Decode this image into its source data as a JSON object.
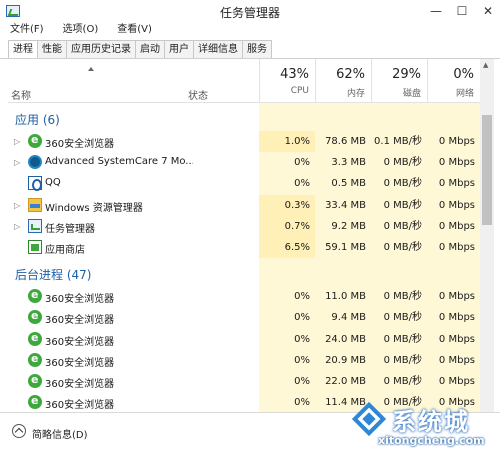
{
  "window": {
    "title": "任务管理器",
    "controls": {
      "minimize": "—",
      "maximize": "☐",
      "close": "✕"
    }
  },
  "menu": [
    "文件(F)",
    "选项(O)",
    "查看(V)"
  ],
  "tabs": [
    "进程",
    "性能",
    "应用历史记录",
    "启动",
    "用户",
    "详细信息",
    "服务"
  ],
  "active_tab": "进程",
  "header": {
    "name": "名称",
    "status": "状态",
    "cpu": {
      "percent": "43%",
      "label": "CPU"
    },
    "memory": {
      "percent": "62%",
      "label": "内存"
    },
    "disk": {
      "percent": "29%",
      "label": "磁盘"
    },
    "network": {
      "percent": "0%",
      "label": "网络"
    }
  },
  "groups": {
    "apps": {
      "label": "应用 (6)",
      "rows": [
        {
          "name": "360安全浏览器",
          "icon": "360-browser-icon",
          "expandable": true,
          "cpu": "1.0%",
          "memory": "78.6 MB",
          "disk": "0.1 MB/秒",
          "network": "0 Mbps"
        },
        {
          "name": "Advanced SystemCare 7 Mo...",
          "icon": "advanced-systemcare-icon",
          "expandable": true,
          "cpu": "0%",
          "memory": "3.3 MB",
          "disk": "0 MB/秒",
          "network": "0 Mbps"
        },
        {
          "name": "QQ",
          "icon": "qq-icon",
          "expandable": false,
          "cpu": "0%",
          "memory": "0.5 MB",
          "disk": "0 MB/秒",
          "network": "0 Mbps"
        },
        {
          "name": "Windows 资源管理器",
          "icon": "explorer-icon",
          "expandable": true,
          "cpu": "0.3%",
          "memory": "33.4 MB",
          "disk": "0 MB/秒",
          "network": "0 Mbps"
        },
        {
          "name": "任务管理器",
          "icon": "task-manager-icon",
          "expandable": true,
          "cpu": "0.7%",
          "memory": "9.2 MB",
          "disk": "0 MB/秒",
          "network": "0 Mbps"
        },
        {
          "name": "应用商店",
          "icon": "store-icon",
          "expandable": false,
          "cpu": "6.5%",
          "memory": "59.1 MB",
          "disk": "0 MB/秒",
          "network": "0 Mbps"
        }
      ]
    },
    "background": {
      "label": "后台进程 (47)",
      "rows": [
        {
          "name": "360安全浏览器",
          "icon": "360-browser-icon",
          "cpu": "0%",
          "memory": "11.0 MB",
          "disk": "0 MB/秒",
          "network": "0 Mbps"
        },
        {
          "name": "360安全浏览器",
          "icon": "360-browser-icon",
          "cpu": "0%",
          "memory": "9.4 MB",
          "disk": "0 MB/秒",
          "network": "0 Mbps"
        },
        {
          "name": "360安全浏览器",
          "icon": "360-browser-icon",
          "cpu": "0%",
          "memory": "24.0 MB",
          "disk": "0 MB/秒",
          "network": "0 Mbps"
        },
        {
          "name": "360安全浏览器",
          "icon": "360-browser-icon",
          "cpu": "0%",
          "memory": "20.9 MB",
          "disk": "0 MB/秒",
          "network": "0 Mbps"
        },
        {
          "name": "360安全浏览器",
          "icon": "360-browser-icon",
          "cpu": "0%",
          "memory": "22.0 MB",
          "disk": "0 MB/秒",
          "network": "0 Mbps"
        },
        {
          "name": "360安全浏览器",
          "icon": "360-browser-icon",
          "cpu": "0%",
          "memory": "11.4 MB",
          "disk": "0 MB/秒",
          "network": "0 Mbps"
        }
      ]
    }
  },
  "footer": {
    "label": "简略信息(D)"
  },
  "watermark": {
    "text": "系统城",
    "url": "xitongcheng.com"
  },
  "colors": {
    "group_label": "#1e5fa8",
    "highlight_strong": "#fff0b8",
    "highlight_light": "#fff8d6"
  }
}
